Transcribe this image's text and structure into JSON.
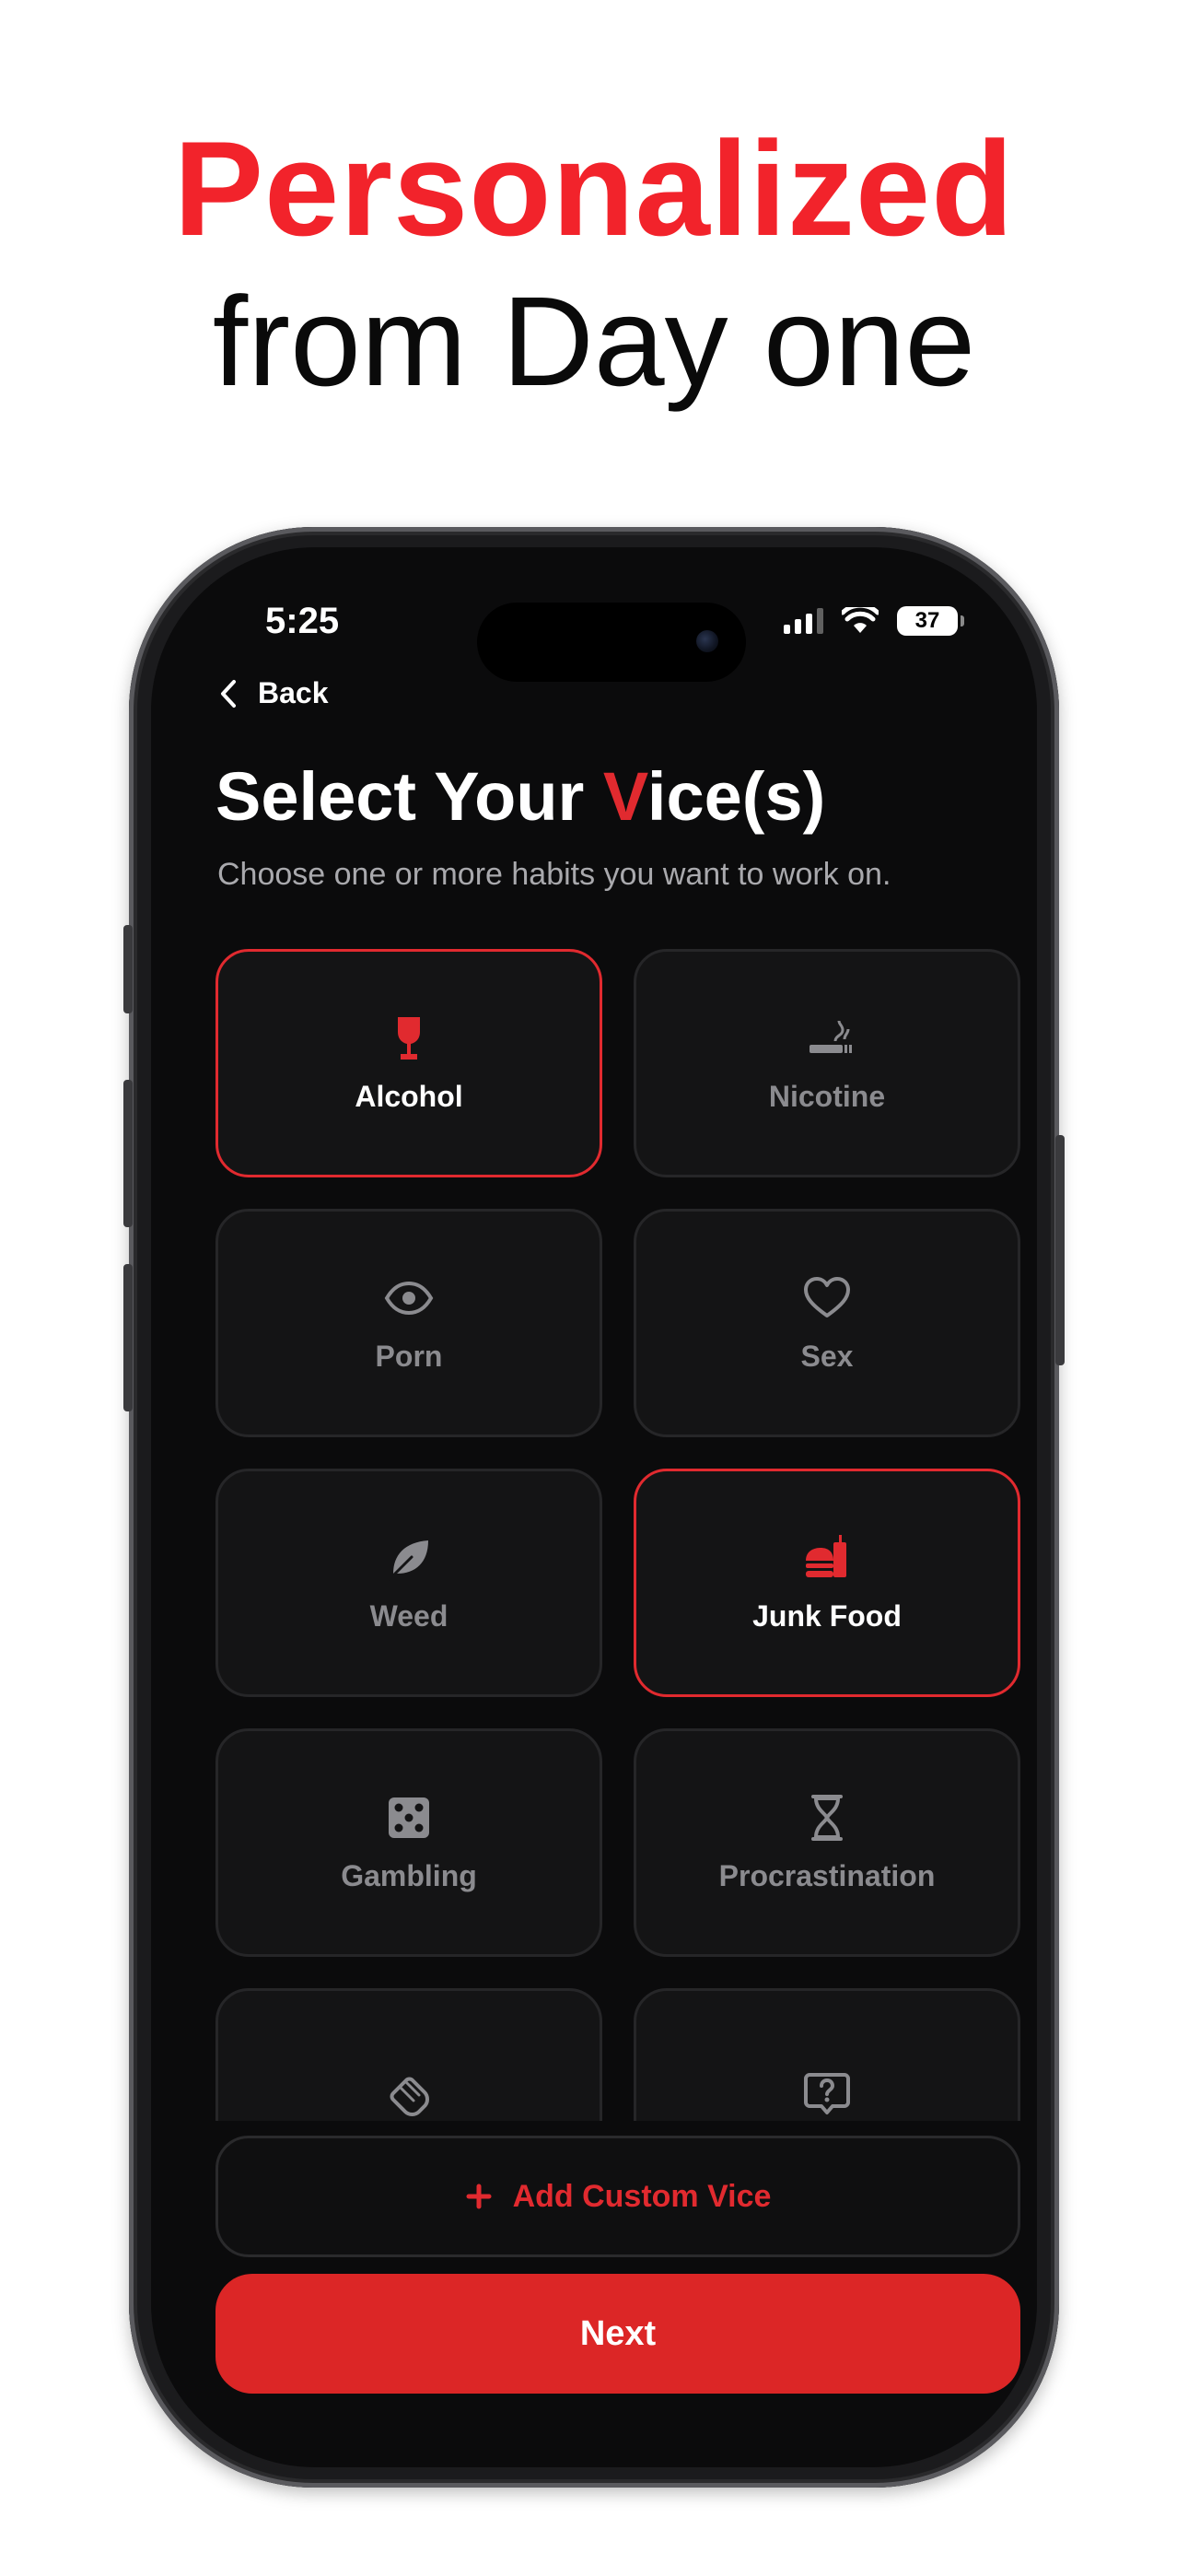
{
  "headline": {
    "line1": "Personalized",
    "line2": "from Day one"
  },
  "status_bar": {
    "time": "5:25",
    "battery": "37"
  },
  "nav": {
    "back_label": "Back"
  },
  "screen": {
    "title_before": "Select Your ",
    "title_accent": "V",
    "title_after": "ice(s)",
    "subtitle": "Choose one or more habits you want to work on."
  },
  "vices": [
    {
      "label": "Alcohol",
      "icon": "wine-glass-icon",
      "selected": true
    },
    {
      "label": "Nicotine",
      "icon": "cigarette-icon",
      "selected": false
    },
    {
      "label": "Porn",
      "icon": "eye-icon",
      "selected": false
    },
    {
      "label": "Sex",
      "icon": "heart-icon",
      "selected": false
    },
    {
      "label": "Weed",
      "icon": "leaf-icon",
      "selected": false
    },
    {
      "label": "Junk Food",
      "icon": "burger-drink-icon",
      "selected": true
    },
    {
      "label": "Gambling",
      "icon": "dice-icon",
      "selected": false
    },
    {
      "label": "Procrastination",
      "icon": "hourglass-icon",
      "selected": false
    },
    {
      "label": "",
      "icon": "hands-icon",
      "selected": false
    },
    {
      "label": "",
      "icon": "question-bubble-icon",
      "selected": false
    }
  ],
  "buttons": {
    "add_custom": "Add Custom Vice",
    "next": "Next"
  },
  "colors": {
    "accent": "#e12a2f",
    "headline_red": "#f2232b",
    "screen_bg": "#0b0b0c",
    "card_bg": "#141415",
    "next_bg": "#dc2626"
  }
}
